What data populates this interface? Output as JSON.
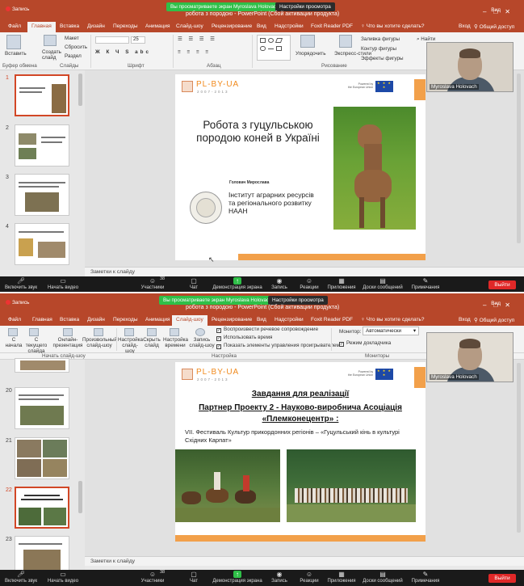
{
  "screen1": {
    "recording": "Запись",
    "share_banner": "Вы просматриваете экран Myroslava Holovach",
    "view_options": "Настройки просмотра",
    "view_label": "Вид",
    "title": "робота з породою - PowerPoint (Сбой активации продукта)",
    "tabs": [
      "Файл",
      "Главная",
      "Вставка",
      "Дизайн",
      "Переходы",
      "Анимация",
      "Слайд-шоу",
      "Рецензирование",
      "Вид",
      "Надстройки",
      "Foxit Reader PDF"
    ],
    "active_tab": "Главная",
    "help_search": "Что вы хотите сделать?",
    "login": "Вход",
    "share": "Общий доступ",
    "ribbon": {
      "paste": "Вставить",
      "new_slide": "Создать слайд",
      "layout": "Макет",
      "reset": "Сбросить",
      "section": "Раздел",
      "font_size": "25",
      "arrange": "Упорядочить",
      "quick_styles": "Экспресс-стили",
      "shape_fill": "Заливка фигуры",
      "shape_outline": "Контур фигуры",
      "shape_effects": "Эффекты фигуры",
      "find": "Найти",
      "groups": [
        "Буфер обмена",
        "Слайды",
        "Шрифт",
        "Абзац",
        "Рисование"
      ]
    },
    "thumb_numbers": [
      "1",
      "2",
      "3",
      "4"
    ],
    "slide": {
      "logo": "PL-BY-UA",
      "logo_years": "2007-2013",
      "powered": "Powered by\nthe European Union",
      "eu_stars": "★ ★ ★ ★",
      "title": "Робота з гуцульською породою коней в Україні",
      "author": "Головач Мирослава",
      "institute": "Інститут аграрних ресурсів та регіонального розвитку НААН"
    },
    "notes": "Заметки к слайду",
    "video_name": "Myroslava Holovach"
  },
  "screen2": {
    "recording": "Запись",
    "share_banner": "Вы просматриваете экран Myroslava Holovach",
    "view_options": "Настройки просмотра",
    "view_label": "Вид",
    "title": "робота з породою - PowerPoint (Сбой активации продукта)",
    "tabs": [
      "Файл",
      "Главная",
      "Вставка",
      "Дизайн",
      "Переходы",
      "Анимация",
      "Слайд-шоу",
      "Рецензирование",
      "Вид",
      "Надстройки",
      "Foxit Reader PDF"
    ],
    "active_tab": "Слайд-шоу",
    "help_search": "Что вы хотите сделать?",
    "login": "Вход",
    "share": "Общий доступ",
    "ribbon": {
      "from_start": "С начала",
      "from_current": "С текущего слайда",
      "online": "Онлайн-презентация",
      "custom": "Произвольный слайд-шоу",
      "setup": "Настройка слайд-шоу",
      "hide": "Скрыть слайд",
      "rehearse": "Настройка времени",
      "record": "Запись слайд-шоу",
      "play_narration": "Воспроизвести речевое сопровождение",
      "use_timings": "Использовать время",
      "show_controls": "Показать элементы управления проигрывателем",
      "monitor_label": "Монитор:",
      "monitor_value": "Автоматически",
      "presenter_view": "Режим докладчика",
      "groups": [
        "Начать слайд-шоу",
        "Настройка",
        "Мониторы"
      ]
    },
    "thumb_numbers": [
      "20",
      "21",
      "22",
      "23"
    ],
    "slide": {
      "logo": "PL-BY-UA",
      "logo_years": "2007-2013",
      "powered": "Powered by\nthe European Union",
      "eu_stars": "★ ★ ★ ★",
      "heading1": "Завдання для реалізації",
      "heading2": "Партнер Проекту 2 - Науково-виробнича Асоціація «Племконецентр» :",
      "body": "VII. Фестиваль Культур прикордонних регіонів – «Гуцульський кінь в культурі Східних Карпат»"
    },
    "notes": "Заметки к слайду",
    "video_name": "Myroslava Holovach"
  },
  "zoom": {
    "items": [
      "Включить звук",
      "Начать видео",
      "Участники",
      "Чат",
      "Демонстрация экрана",
      "Запись",
      "Реакции",
      "Приложения",
      "Доски сообщений",
      "Примечания"
    ],
    "participants_count": "38",
    "leave": "Выйти"
  },
  "colors": {
    "powerpoint_red": "#b7472a",
    "zoom_green": "#2fbf48",
    "leave_red": "#e02828",
    "brand_orange": "#f18a1d"
  }
}
